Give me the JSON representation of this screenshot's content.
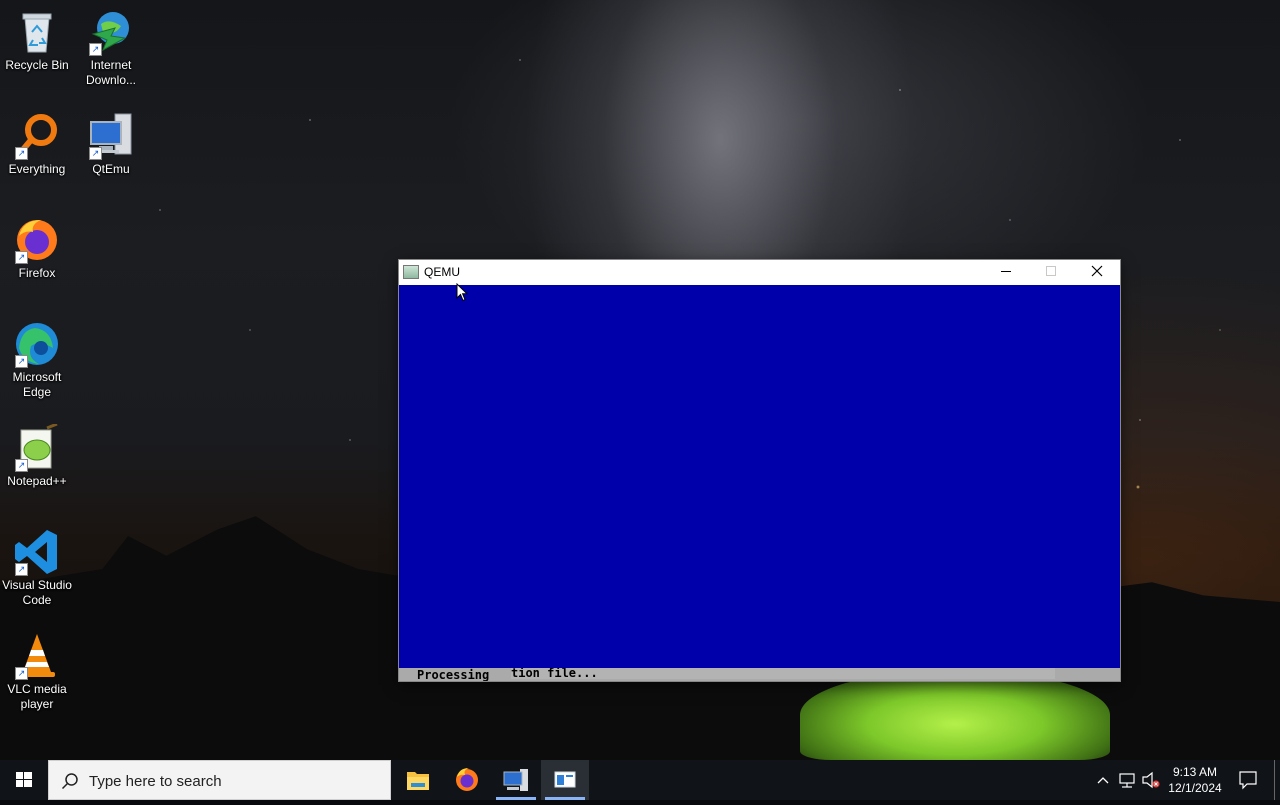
{
  "desktop": {
    "icons": [
      {
        "label": "Recycle Bin",
        "icon": "recycle-bin-icon"
      },
      {
        "label": "Internet Downlo...",
        "icon": "internet-download-manager-icon"
      },
      {
        "label": "Everything",
        "icon": "everything-search-icon"
      },
      {
        "label": "QtEmu",
        "icon": "qtemu-icon"
      },
      {
        "label": "Firefox",
        "icon": "firefox-icon"
      },
      {
        "label": "Microsoft Edge",
        "icon": "edge-icon"
      },
      {
        "label": "Notepad++",
        "icon": "notepad-plus-plus-icon"
      },
      {
        "label": "Visual Studio Code",
        "icon": "vscode-icon"
      },
      {
        "label": "VLC media player",
        "icon": "vlc-icon"
      }
    ]
  },
  "qemu_window": {
    "title": "QEMU",
    "screen_color": "#0000aa",
    "status_bar": {
      "text_left": "Processing",
      "text_right": "tion file..."
    }
  },
  "taskbar": {
    "search_placeholder": "Type here to search",
    "apps": [
      {
        "name": "File Explorer",
        "icon": "file-explorer-icon"
      },
      {
        "name": "Firefox",
        "icon": "firefox-icon"
      },
      {
        "name": "QtEmu",
        "icon": "qtemu-icon"
      },
      {
        "name": "QEMU",
        "icon": "qemu-window-icon"
      }
    ],
    "clock": {
      "time": "9:13 AM",
      "date": "12/1/2024"
    }
  }
}
